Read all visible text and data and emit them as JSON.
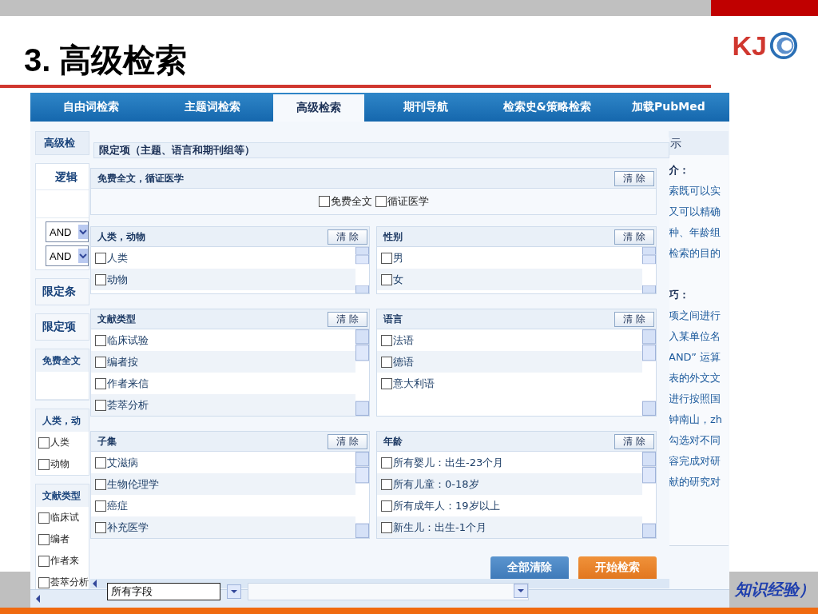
{
  "slide": {
    "title": "3. 高级检索",
    "logo": "KJ",
    "footer_text": "知识经验）"
  },
  "tabs": [
    {
      "label": "自由词检索",
      "selected": false
    },
    {
      "label": "主题词检索",
      "selected": false
    },
    {
      "label": "高级检索",
      "selected": true
    },
    {
      "label": "期刊导航",
      "selected": false
    },
    {
      "label": "检索史&策略检索",
      "selected": false
    },
    {
      "label": "加载PubMed",
      "selected": false
    }
  ],
  "left_panel": {
    "blocks": [
      {
        "kind": "banner",
        "title": "高级检"
      },
      {
        "kind": "logic",
        "title": "逻辑",
        "selects": [
          "AND",
          "AND"
        ]
      },
      {
        "kind": "plain",
        "title": "限定条"
      },
      {
        "kind": "plain",
        "title": "限定项"
      },
      {
        "kind": "empty",
        "title": "免费全文"
      },
      {
        "kind": "list",
        "title": "人类，动",
        "items": [
          {
            "label": "人类",
            "checked": false
          },
          {
            "label": "动物",
            "checked": false
          }
        ]
      },
      {
        "kind": "list",
        "title": "文献类型",
        "items": [
          {
            "label": "临床试",
            "checked": false
          },
          {
            "label": "编者",
            "checked": false
          },
          {
            "label": "作者来",
            "checked": false
          },
          {
            "label": "荟萃分析",
            "checked": false
          }
        ]
      }
    ]
  },
  "dialog": {
    "title": "限定项（主题、语言和期刊组等）",
    "free_section": {
      "title": "免费全文，循证医学",
      "clear_label": "清 除",
      "options": [
        {
          "label": "免费全文",
          "checked": false
        },
        {
          "label": "循证医学",
          "checked": false
        }
      ]
    },
    "groups": [
      {
        "title": "人类，动物",
        "clear_label": "清 除",
        "items": [
          {
            "label": "人类",
            "checked": false
          },
          {
            "label": "动物",
            "checked": false
          }
        ]
      },
      {
        "title": "性别",
        "clear_label": "清 除",
        "items": [
          {
            "label": "男",
            "checked": false
          },
          {
            "label": "女",
            "checked": false
          }
        ]
      },
      {
        "title": "文献类型",
        "clear_label": "清 除",
        "items": [
          {
            "label": "临床试验",
            "checked": false
          },
          {
            "label": "编者按",
            "checked": false
          },
          {
            "label": "作者来信",
            "checked": false
          },
          {
            "label": "荟萃分析",
            "checked": false
          }
        ]
      },
      {
        "title": "语言",
        "clear_label": "清 除",
        "items": [
          {
            "label": "法语",
            "checked": false
          },
          {
            "label": "德语",
            "checked": false
          },
          {
            "label": "意大利语",
            "checked": false
          }
        ]
      },
      {
        "title": "子集",
        "clear_label": "清 除",
        "items": [
          {
            "label": "艾滋病",
            "checked": false
          },
          {
            "label": "生物伦理学",
            "checked": false
          },
          {
            "label": "癌症",
            "checked": false
          },
          {
            "label": "补充医学",
            "checked": false
          }
        ]
      },
      {
        "title": "年龄",
        "clear_label": "清 除",
        "items": [
          {
            "label": "所有婴儿：出生-23个月",
            "checked": false
          },
          {
            "label": "所有儿童：0-18岁",
            "checked": false
          },
          {
            "label": "所有成年人：19岁以上",
            "checked": false
          },
          {
            "label": "新生儿：出生-1个月",
            "checked": false
          }
        ]
      }
    ],
    "buttons": [
      {
        "label": "全部清除",
        "kind": "secondary"
      },
      {
        "label": "开始检索",
        "kind": "primary"
      }
    ]
  },
  "field_row": {
    "value": "所有字段"
  },
  "hints": {
    "title": "示",
    "sections": [
      {
        "heading": "介：",
        "lines": [
          "索既可以实",
          "又可以精确",
          "种、年龄组",
          "检索的目的"
        ]
      },
      {
        "heading": "巧：",
        "lines": [
          "项之间进行",
          "入某单位名",
          "AND” 运算",
          "表的外文文",
          "进行按照国",
          "钟南山，zh",
          "勾选对不同",
          "容完成对研",
          "献的研究对"
        ]
      }
    ]
  }
}
